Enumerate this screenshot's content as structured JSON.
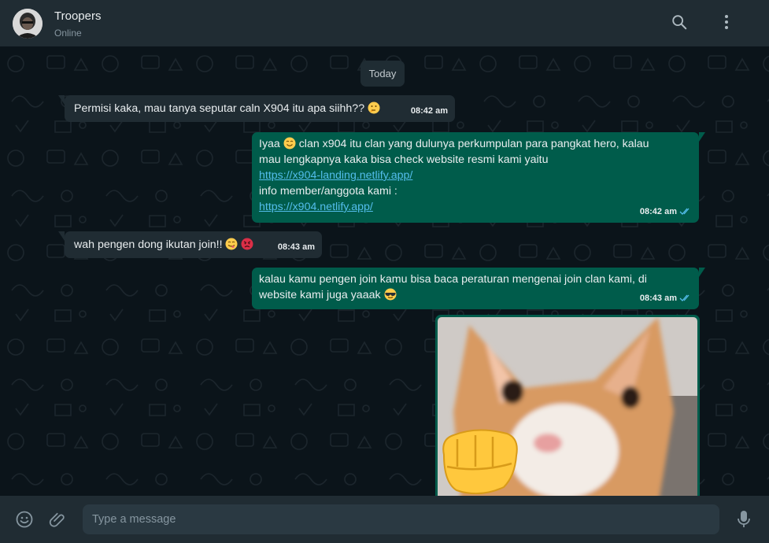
{
  "header": {
    "contact_name": "Troopers",
    "status": "Online",
    "avatar_icon": "avatar-photo",
    "search_icon": "search-icon",
    "menu_icon": "kebab-menu-icon"
  },
  "chat": {
    "date_divider": "Today",
    "messages": [
      {
        "direction": "incoming",
        "text": "Permisi kaka, mau tanya seputar caln X904 itu apa siihh?? ",
        "emoji": [
          "thinking-face"
        ],
        "time": "08:42 am"
      },
      {
        "direction": "outgoing",
        "line1_a": " Iyaa ",
        "line1_b": " clan x904 itu clan yang dulunya perkumpulan para pangkat hero, kalau",
        "line2": "mau lengkapnya kaka bisa check website resmi kami yaitu",
        "link1": "https://x904-landing.netlify.app/",
        "line4": "info member/anggota kami :",
        "link2": "https://x904.netlify.app/",
        "emoji": [
          "smiling-face"
        ],
        "time": "08:42 am",
        "read": true
      },
      {
        "direction": "incoming",
        "text": "wah pengen dong ikutan join!! ",
        "emoji": [
          "face-savoring-food",
          "angry-face"
        ],
        "time": "08:43 am"
      },
      {
        "direction": "outgoing",
        "line1": " kalau kamu pengen join kamu bisa baca peraturan mengenai join clan kami, di",
        "line2": "website kami juga yaaak ",
        "emoji": [
          "sunglasses-face"
        ],
        "time": "08:43 am",
        "read": true
      },
      {
        "direction": "outgoing",
        "type": "image",
        "image_icon": "cat-with-fist-sticker"
      }
    ]
  },
  "composer": {
    "placeholder": "Type a message",
    "emoji_icon": "emoji-icon",
    "attach_icon": "paperclip-icon",
    "mic_icon": "microphone-icon"
  },
  "colors": {
    "header_bg": "#202c33",
    "chat_bg": "#0b141a",
    "incoming_bubble": "#202c33",
    "outgoing_bubble": "#005c4b",
    "link": "#53bdeb",
    "read_ticks": "#53bdeb"
  }
}
